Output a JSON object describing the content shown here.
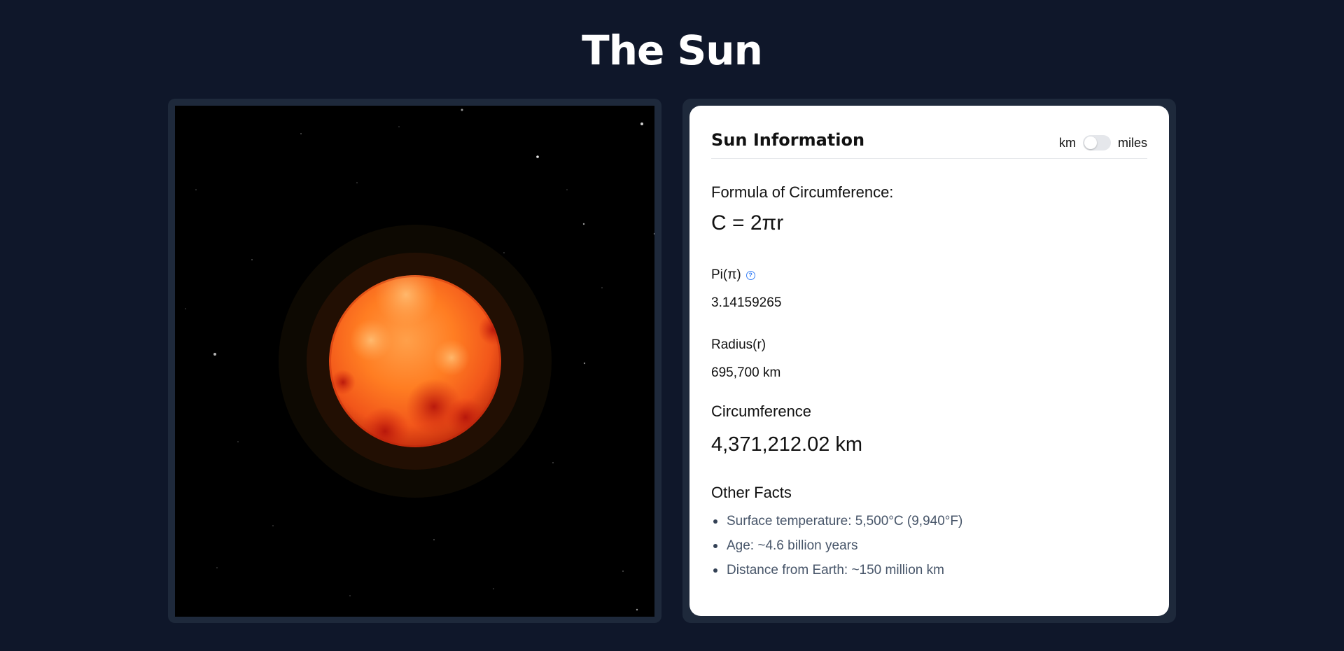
{
  "page": {
    "title": "The Sun"
  },
  "viewer": {
    "object": "sun-sphere"
  },
  "info": {
    "title": "Sun Information",
    "unit_toggle": {
      "left_label": "km",
      "right_label": "miles",
      "selected": "km"
    },
    "formula_label": "Formula of Circumference:",
    "formula": "C = 2πr",
    "pi_label": "Pi(π)",
    "pi_help_icon": "question-circle-icon",
    "pi_value": "3.14159265",
    "radius_label": "Radius(r)",
    "radius_value": "695,700 km",
    "circumference_label": "Circumference",
    "circumference_value": "4,371,212.02 km",
    "facts_label": "Other Facts",
    "facts": [
      "Surface temperature: 5,500°C (9,940°F)",
      "Age: ~4.6 billion years",
      "Distance from Earth: ~150 million km"
    ]
  },
  "colors": {
    "background": "#0f172a",
    "panel": "#1e293b",
    "accent": "#3b82f6",
    "sun": "#ff7a1f"
  }
}
